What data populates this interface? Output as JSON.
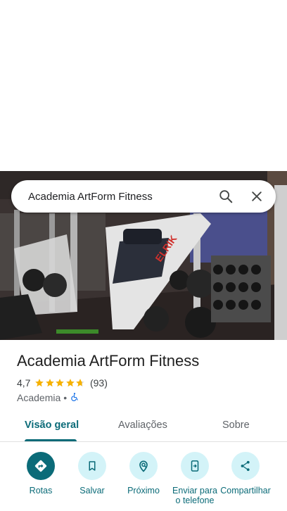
{
  "search": {
    "query": "Academia ArtForm Fitness"
  },
  "icons": {
    "search": "search-icon",
    "close": "close-icon",
    "directions": "directions-icon",
    "bookmark": "bookmark-icon",
    "nearby": "nearby-icon",
    "send": "send-to-phone-icon",
    "share": "share-icon",
    "wheelchair": "wheelchair-icon"
  },
  "place": {
    "name": "Academia ArtForm Fitness",
    "rating": "4,7",
    "stars": 4.7,
    "reviews": "(93)",
    "category": "Academia",
    "separator": "•"
  },
  "tabs": [
    {
      "label": "Visão geral",
      "active": true
    },
    {
      "label": "Avaliações",
      "active": false
    },
    {
      "label": "Sobre",
      "active": false
    }
  ],
  "actions": [
    {
      "label": "Rotas",
      "icon": "directions-icon"
    },
    {
      "label": "Salvar",
      "icon": "bookmark-icon"
    },
    {
      "label": "Próximo",
      "icon": "nearby-icon"
    },
    {
      "label": "Enviar para o telefone",
      "icon": "send-to-phone-icon"
    },
    {
      "label": "Compartilhar",
      "icon": "share-icon"
    }
  ],
  "photo": {
    "machine_brand": "ELRIK"
  },
  "colors": {
    "accent": "#0b6b78",
    "action_bg": "#d3f3f8",
    "star": "#f6b100",
    "wheelchair": "#1a73e8"
  }
}
